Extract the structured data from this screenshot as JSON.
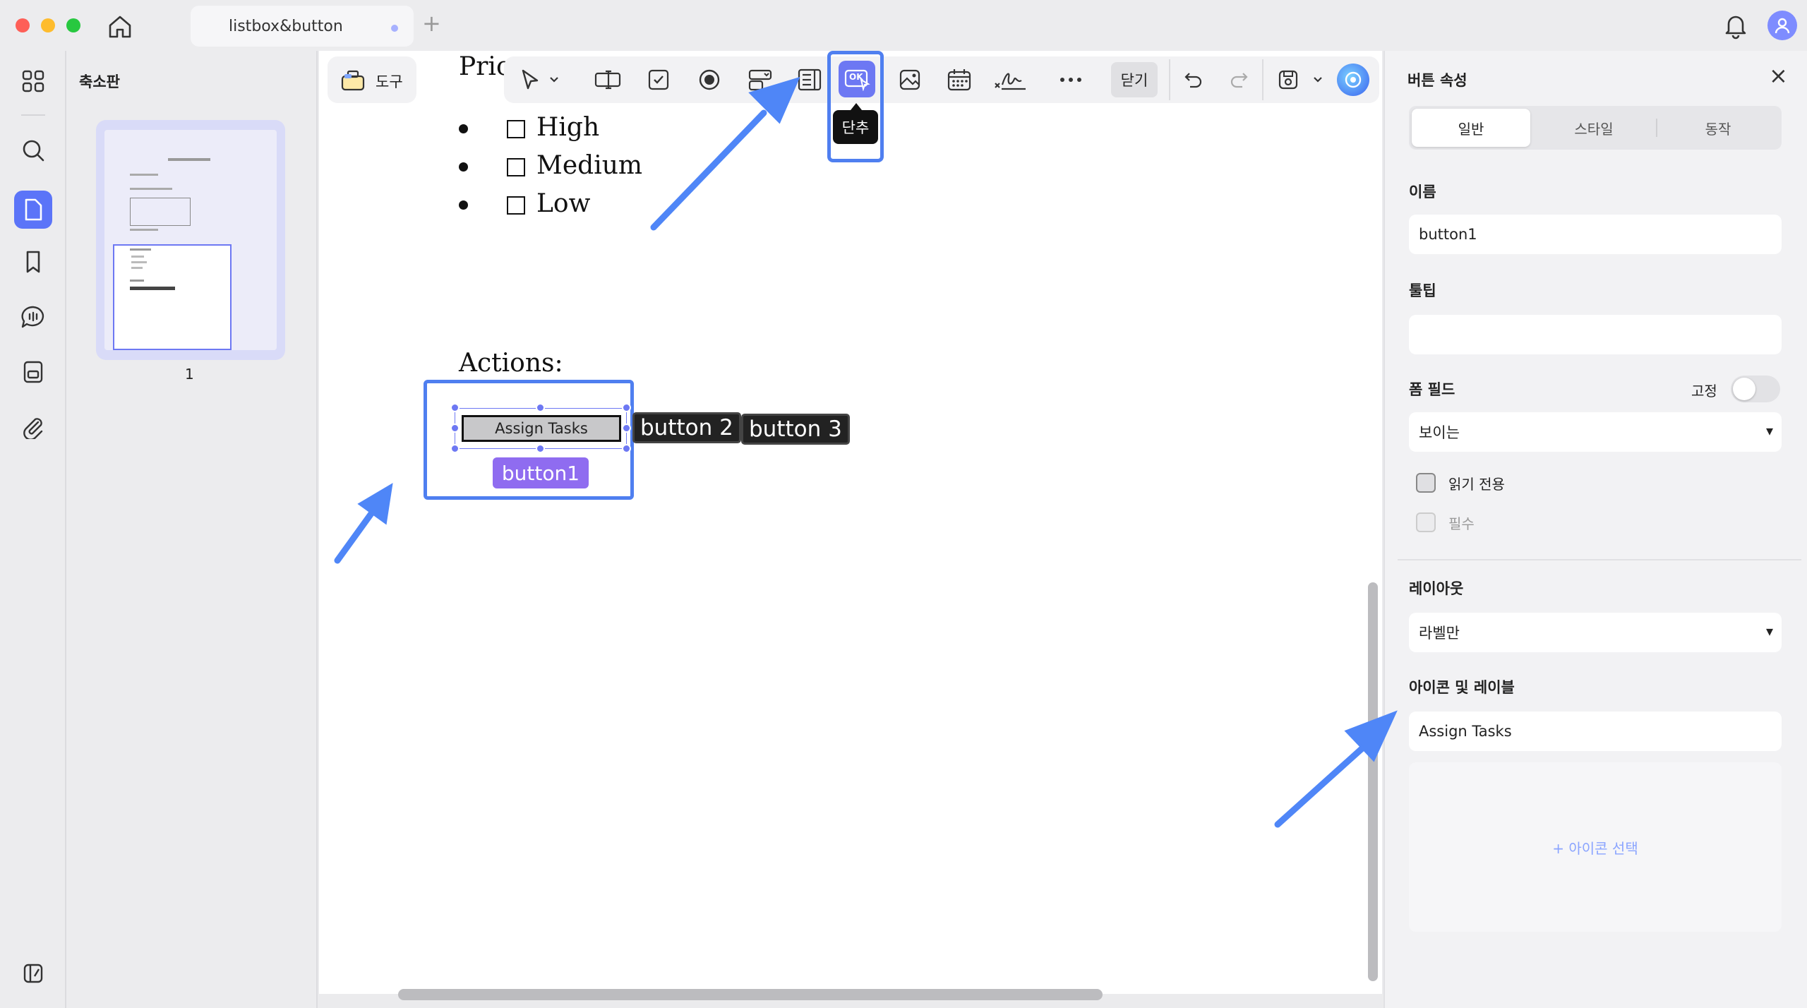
{
  "window": {
    "tab_title": "listbox&button",
    "new_tab_symbol": "+"
  },
  "sidebar": {
    "panel_title": "축소판",
    "page_number": "1",
    "icons": [
      "grid-icon",
      "search-icon",
      "pages-icon",
      "bookmark-icon",
      "comment-icon",
      "stamp-icon",
      "attachment-icon",
      "sidebar-toggle-icon"
    ]
  },
  "toolbar": {
    "tools_label": "도구",
    "close_label": "닫기",
    "tooltip": "단추",
    "button_icon_text": "OK"
  },
  "document": {
    "heading_fragment": "Pric",
    "priority_items": [
      "High",
      "Medium",
      "Low"
    ],
    "actions_label": "Actions:",
    "selected_button_text": "Assign Tasks",
    "selected_button_name": "button1",
    "button2_text": "button 2",
    "button3_text": "button 3"
  },
  "properties": {
    "title": "버튼 속성",
    "close_symbol": "×",
    "tabs": [
      "일반",
      "스타일",
      "동작"
    ],
    "active_tab": "일반",
    "name_label": "이름",
    "name_value": "button1",
    "tooltip_label": "툴팁",
    "tooltip_value": "",
    "form_field_label": "폼 필드",
    "pin_label": "고정",
    "visibility_value": "보이는",
    "readonly_label": "읽기 전용",
    "required_label": "필수",
    "layout_label": "레이아웃",
    "layout_value": "라벨만",
    "icon_label_section": "아이콘 및 레이블",
    "label_value": "Assign Tasks",
    "select_icon_label": "+ 아이콘 선택",
    "dropdown_caret": "▾"
  },
  "colors": {
    "accent": "#4f7ff0",
    "selection_handle": "#6d78f3",
    "name_badge": "#8f6cf0",
    "annotation_arrow": "#4f86f7"
  }
}
